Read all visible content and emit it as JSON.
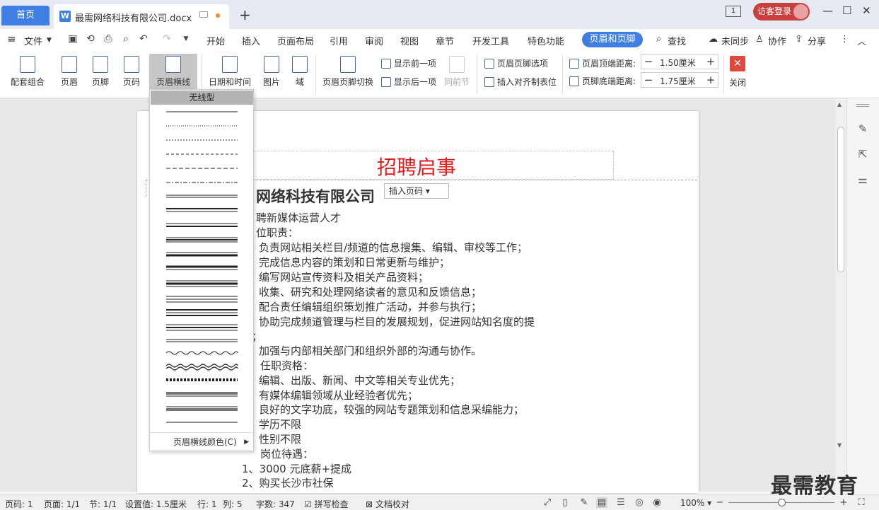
{
  "tabs": {
    "home": "首页",
    "doc_title": "最需网络科技有限公司.docx",
    "new_tab": "+"
  },
  "window": {
    "page_indicator": "1",
    "login": "访客登录",
    "minimize": "—",
    "maximize": "☐",
    "close": "✕"
  },
  "menu": {
    "file": "文件",
    "items": [
      "开始",
      "插入",
      "页面布局",
      "引用",
      "审阅",
      "视图",
      "章节",
      "开发工具",
      "特色功能"
    ],
    "active": "页眉和页脚",
    "search": "查找",
    "sync": "未同步",
    "collab": "协作",
    "share": "分享"
  },
  "toolbar": {
    "combo": "配套组合",
    "header": "页眉",
    "footer": "页脚",
    "page_num": "页码",
    "header_line": "页眉横线",
    "datetime": "日期和时间",
    "picture": "图片",
    "field": "域",
    "switch": "页眉页脚切换",
    "show_prev": "显示前一项",
    "show_next": "显示后一项",
    "prev_section": "同前节",
    "hf_options": "页眉页脚选项",
    "insert_tab": "插入对齐制表位",
    "top_dist_label": "页眉顶端距离:",
    "top_dist_value": "1.50厘米",
    "bottom_dist_label": "页脚底端距离:",
    "bottom_dist_value": "1.75厘米",
    "close": "关闭"
  },
  "dropdown": {
    "header": "无线型",
    "color_item": "页眉横线颜色(C)"
  },
  "document": {
    "header_title": "招聘启事",
    "company": "网络科技有限公司",
    "insert_page_num": "插入页码",
    "lines": [
      "聘新媒体运营人才",
      "位职责：",
      "负责网站相关栏目/频道的信息搜集、编辑、审校等工作；",
      "完成信息内容的策划和日常更新与维护；",
      "编写网站宣传资料及相关产品资料；",
      "收集、研究和处理网络读者的意见和反馈信息；",
      "配合责任编辑组织策划推广活动，并参与执行；",
      "协助完成频道管理与栏目的发展规划，促进网站知名度的提",
      "；",
      "加强与内部相关部门和组织外部的沟通与协作。",
      "任职资格：",
      "编辑、出版、新闻、中文等相关专业优先；",
      "有媒体编辑领域从业经验者优先；",
      "良好的文字功底，较强的网站专题策划和信息采编能力；",
      "学历不限",
      "性别不限",
      "岗位待遇：",
      "1、3000 元底薪+提成",
      "2、购买长沙市社保"
    ]
  },
  "status": {
    "page": "页码: 1",
    "pages": "页面: 1/1",
    "section": "节: 1/1",
    "setting": "设置值: 1.5厘米",
    "row": "行: 1",
    "col": "列: 5",
    "words": "字数: 347",
    "spell": "拼写检查",
    "proof": "文档校对",
    "zoom": "100%"
  },
  "watermark": "最需教育"
}
